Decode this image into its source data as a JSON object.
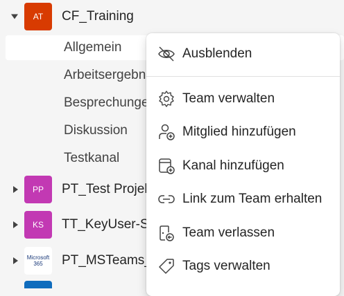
{
  "teams": [
    {
      "initials": "AT",
      "name": "CF_Training",
      "color": "#d83b01",
      "expanded": true
    },
    {
      "initials": "PP",
      "name": "PT_Test Projekt",
      "color": "#c239b3",
      "expanded": false
    },
    {
      "initials": "KS",
      "name": "TT_KeyUser-Sp",
      "color": "#c239b3",
      "expanded": false
    },
    {
      "logo_line1": "Microsoft",
      "logo_line2": "365",
      "name": "PT_MSTeams_",
      "expanded": false
    }
  ],
  "channels": [
    "Allgemein",
    "Arbeitsergebnisse",
    "Besprechungen",
    "Diskussion",
    "Testkanal"
  ],
  "context_menu": {
    "items": [
      {
        "label": "Ausblenden",
        "icon": "eye-off-icon"
      },
      {
        "label": "Team verwalten",
        "icon": "gear-icon"
      },
      {
        "label": "Mitglied hinzufügen",
        "icon": "person-add-icon"
      },
      {
        "label": "Kanal hinzufügen",
        "icon": "channel-add-icon"
      },
      {
        "label": "Link zum Team erhalten",
        "icon": "link-icon"
      },
      {
        "label": "Team verlassen",
        "icon": "leave-icon"
      },
      {
        "label": "Tags verwalten",
        "icon": "tag-icon"
      }
    ]
  },
  "colors": {
    "sidebar_bg": "#f5f5f5",
    "menu_bg": "#ffffff",
    "accent_blue": "#0f6cbd"
  }
}
